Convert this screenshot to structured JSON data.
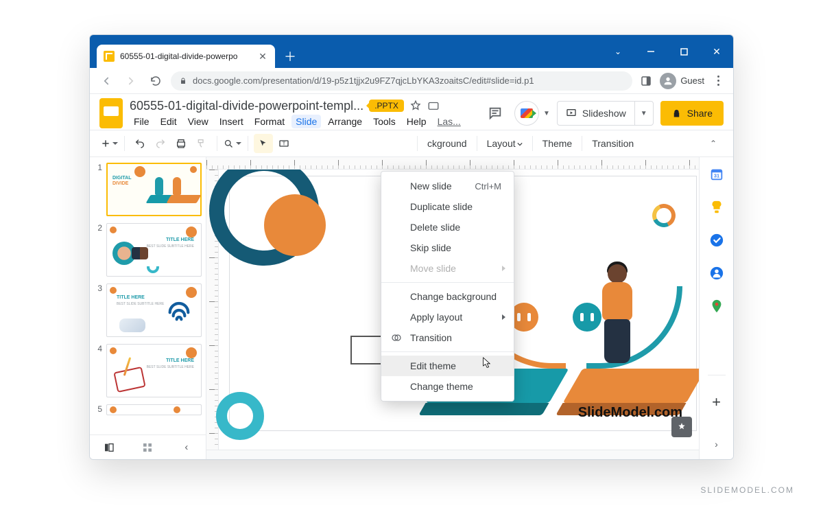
{
  "browser": {
    "tab_title": "60555-01-digital-divide-powerpo",
    "url": "docs.google.com/presentation/d/19-p5z1tjjx2u9FZ7qjcLbYKA3zoaitsC/edit#slide=id.p1",
    "guest_label": "Guest"
  },
  "header": {
    "doc_title": "60555-01-digital-divide-powerpoint-templ...",
    "format_badge": ".PPTX",
    "slideshow_label": "Slideshow",
    "share_label": "Share"
  },
  "menubar": {
    "file": "File",
    "edit": "Edit",
    "view": "View",
    "insert": "Insert",
    "format": "Format",
    "slide": "Slide",
    "arrange": "Arrange",
    "tools": "Tools",
    "help": "Help",
    "last": "Las..."
  },
  "toolbar": {
    "background": "ckground",
    "layout": "Layout",
    "theme": "Theme",
    "transition": "Transition"
  },
  "context_menu": {
    "new_slide": "New slide",
    "new_slide_shortcut": "Ctrl+M",
    "duplicate": "Duplicate slide",
    "delete": "Delete slide",
    "skip": "Skip slide",
    "move": "Move slide",
    "change_bg": "Change background",
    "apply_layout": "Apply layout",
    "transition": "Transition",
    "edit_theme": "Edit theme",
    "change_theme": "Change theme"
  },
  "thumbs": [
    "1",
    "2",
    "3",
    "4",
    "5"
  ],
  "thumb_text": {
    "t1_line1": "DIGITAL",
    "t1_line2": "DIVIDE",
    "title_here": "TITLE HERE",
    "subtitle": "BEST SLIDE SUBTITLE HERE"
  },
  "slide": {
    "watermark": "SlideModel.com"
  },
  "page_watermark": "SLIDEMODEL.COM"
}
